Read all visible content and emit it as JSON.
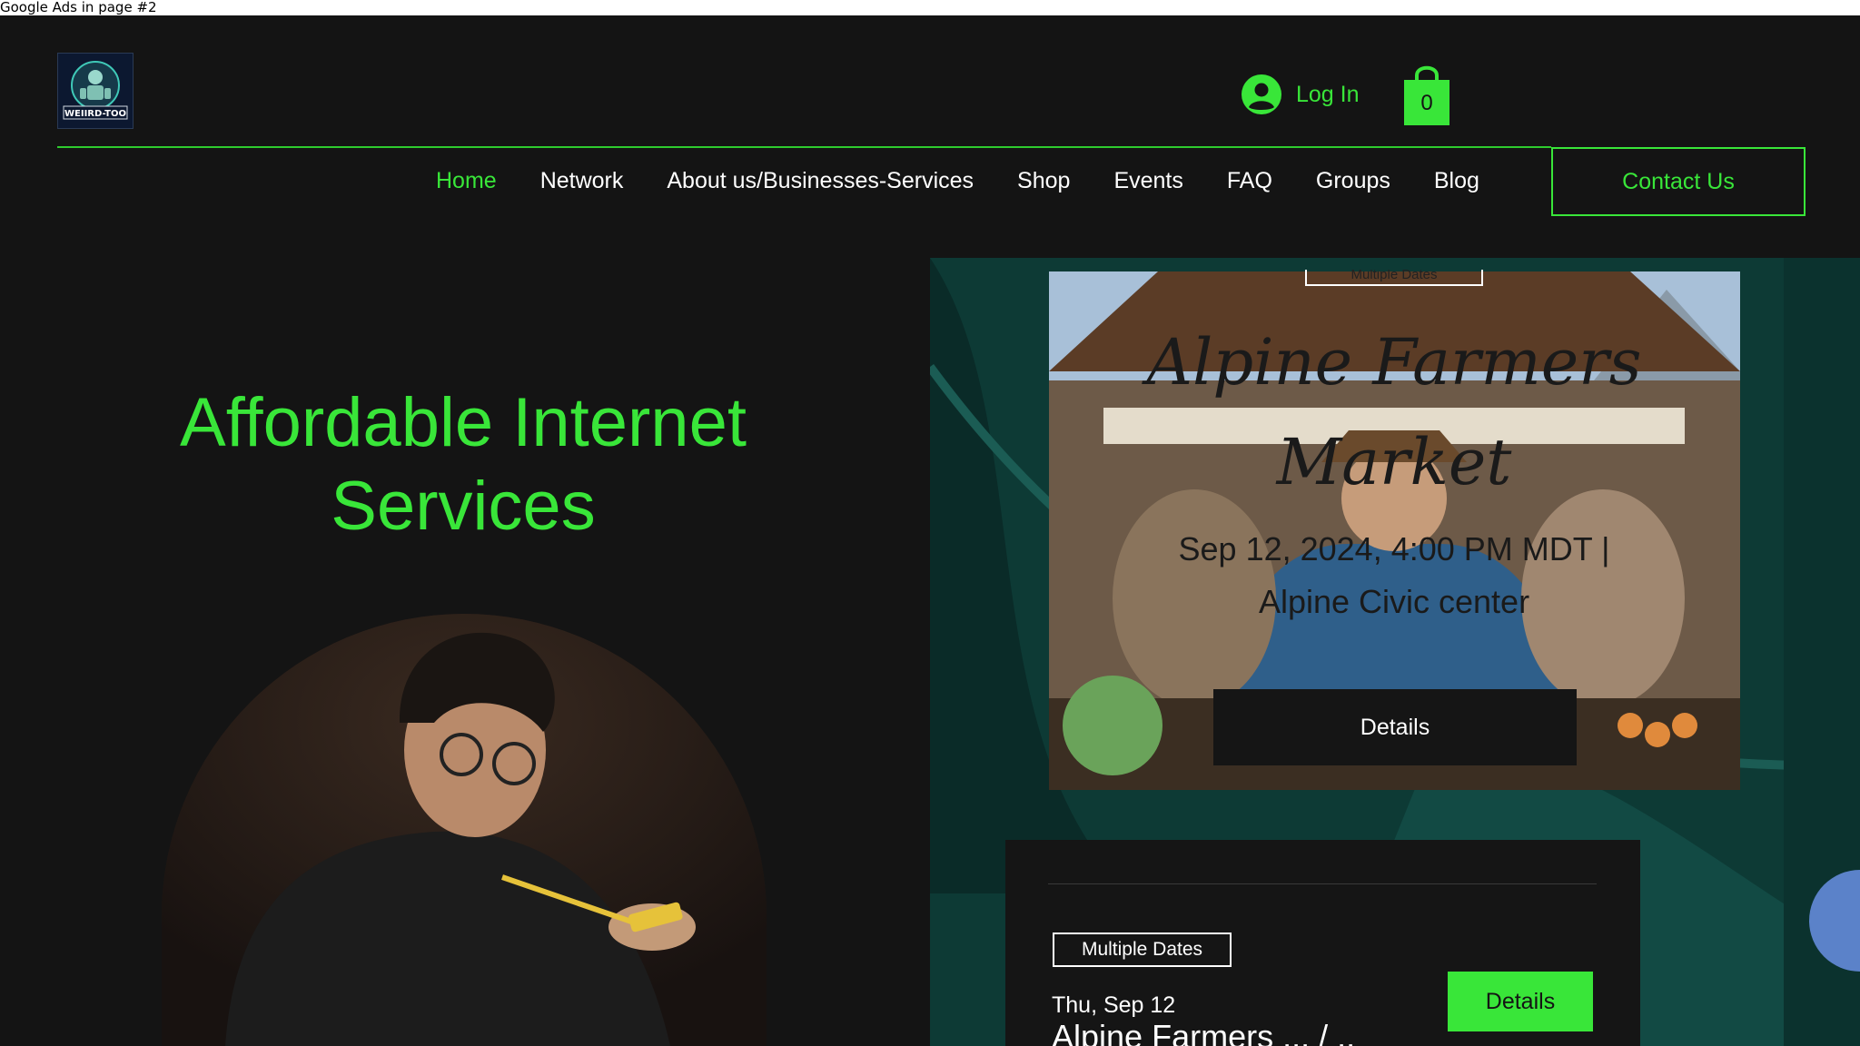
{
  "ads_bar": {
    "text": "Google Ads in page #2"
  },
  "brand": {
    "logo_text": "WEIIRD-TOO"
  },
  "header": {
    "login_label": "Log In",
    "cart_count": "0"
  },
  "nav": {
    "items": [
      {
        "label": "Home",
        "active": true
      },
      {
        "label": "Network",
        "active": false
      },
      {
        "label": "About us/Businesses-Services",
        "active": false
      },
      {
        "label": "Shop",
        "active": false
      },
      {
        "label": "Events",
        "active": false
      },
      {
        "label": "FAQ",
        "active": false
      },
      {
        "label": "Groups",
        "active": false
      },
      {
        "label": "Blog",
        "active": false
      }
    ],
    "contact_label": "Contact Us"
  },
  "hero": {
    "title": "Affordable Internet Services"
  },
  "featured_event": {
    "badge": "Multiple Dates",
    "title": "Alpine Farmers Market",
    "datetime": "Sep 12, 2024, 4:00 PM MDT |",
    "location": "Alpine Civic center",
    "details_label": "Details"
  },
  "event_card": {
    "badge": "Multiple Dates",
    "date": "Thu, Sep 12",
    "title": "Alpine Farmers ... / ..",
    "details_label": "Details"
  },
  "colors": {
    "accent": "#39e639",
    "background": "#141414",
    "panel": "#0d3a35"
  }
}
